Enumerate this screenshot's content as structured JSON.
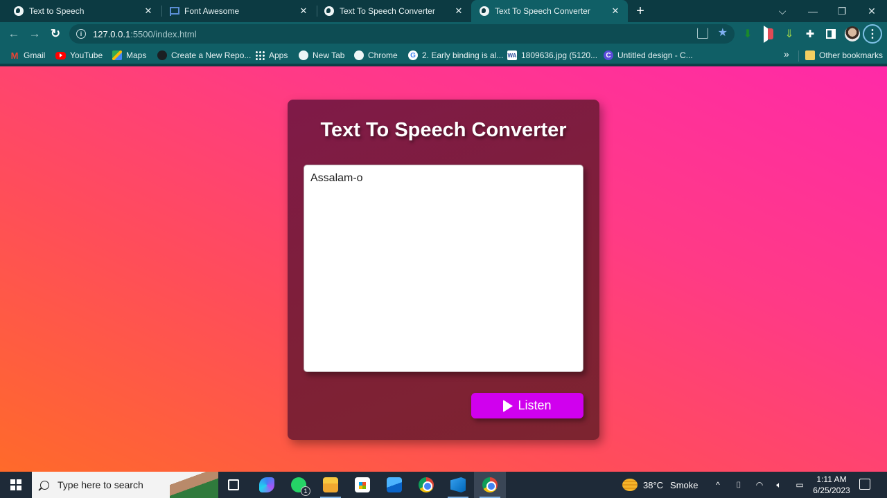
{
  "browser": {
    "tabs": [
      {
        "title": "Text to Speech",
        "icon": "globe-icon",
        "active": false
      },
      {
        "title": "Font Awesome",
        "icon": "flag-icon",
        "active": false
      },
      {
        "title": "Text To Speech Converter",
        "icon": "globe-icon",
        "active": false
      },
      {
        "title": "Text To Speech Converter",
        "icon": "globe-icon",
        "active": true
      }
    ],
    "new_tab_glyph": "+",
    "window_controls": {
      "tab_search": "⌵",
      "minimize": "—",
      "restore": "❐",
      "close": "✕"
    },
    "nav": {
      "back": "←",
      "forward": "→",
      "reload": "↻"
    },
    "address": {
      "host": "127.0.0.1",
      "path": ":5500/index.html",
      "info_glyph": "i"
    },
    "toolbar_icons": [
      "share-icon",
      "bookmark-star-icon",
      "extension-green-icon",
      "extension-pocket-icon",
      "extension-download-icon",
      "extensions-puzzle-icon",
      "side-panel-icon",
      "profile-avatar",
      "menu-icon"
    ],
    "bookmarks": [
      {
        "label": "Gmail",
        "icon": "gmail-icon"
      },
      {
        "label": "YouTube",
        "icon": "youtube-icon"
      },
      {
        "label": "Maps",
        "icon": "maps-icon"
      },
      {
        "label": "Create a New Repo...",
        "icon": "github-icon"
      },
      {
        "label": "Apps",
        "icon": "apps-grid-icon"
      },
      {
        "label": "New Tab",
        "icon": "globe-icon"
      },
      {
        "label": "Chrome",
        "icon": "globe-icon"
      },
      {
        "label": "2. Early binding is al...",
        "icon": "google-icon"
      },
      {
        "label": "1809636.jpg (5120...",
        "icon": "wa-icon"
      },
      {
        "label": "Untitled design - C...",
        "icon": "canva-icon"
      }
    ],
    "bookmarks_overflow": "»",
    "other_bookmarks": "Other bookmarks"
  },
  "app": {
    "title": "Text To Speech Converter",
    "textarea_value": "Assalam-o",
    "listen_label": "Listen",
    "colors": {
      "button": "#d000ee",
      "card": "#7e2036",
      "bg_start": "#ff6a2a",
      "bg_end": "#ff2aa8"
    }
  },
  "taskbar": {
    "search_placeholder": "Type here to search",
    "apps": [
      {
        "name": "task-view",
        "active": false
      },
      {
        "name": "copilot",
        "active": false
      },
      {
        "name": "whatsapp",
        "active": false,
        "badge": "1"
      },
      {
        "name": "file-explorer",
        "active": false
      },
      {
        "name": "microsoft-store",
        "active": false
      },
      {
        "name": "mail",
        "active": false
      },
      {
        "name": "chrome",
        "active": false
      },
      {
        "name": "vscode",
        "active": false
      },
      {
        "name": "chrome-profile",
        "active": true
      }
    ],
    "weather": {
      "temp": "38°C",
      "condition": "Smoke"
    },
    "tray_chevron": "^",
    "time": "1:11 AM",
    "date": "6/25/2023"
  }
}
